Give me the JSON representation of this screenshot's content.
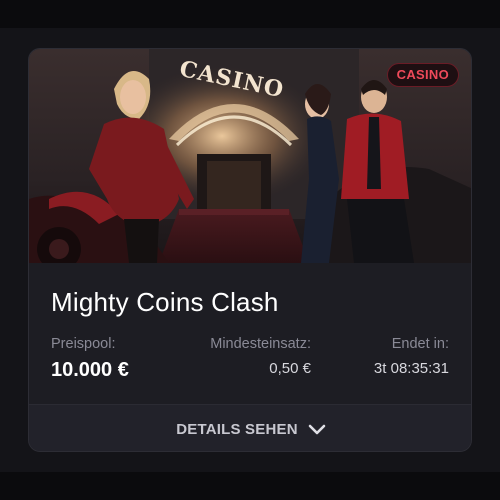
{
  "card": {
    "badge": "CASINO",
    "hero_sign": "CASINO",
    "title": "Mighty Coins Clash",
    "stats": {
      "prize_label": "Preispool:",
      "prize_value": "10.000 €",
      "min_bet_label": "Mindesteinsatz:",
      "min_bet_value": "0,50 €",
      "ends_label": "Endet in:",
      "ends_value": "3t 08:35:31"
    },
    "details_label": "DETAILS SEHEN",
    "icons": {
      "details_toggle": "chevron-down-icon"
    }
  },
  "colors": {
    "badge_text": "#ef4a5a",
    "card_background": "#1d1d23",
    "page_background": "#141418"
  }
}
